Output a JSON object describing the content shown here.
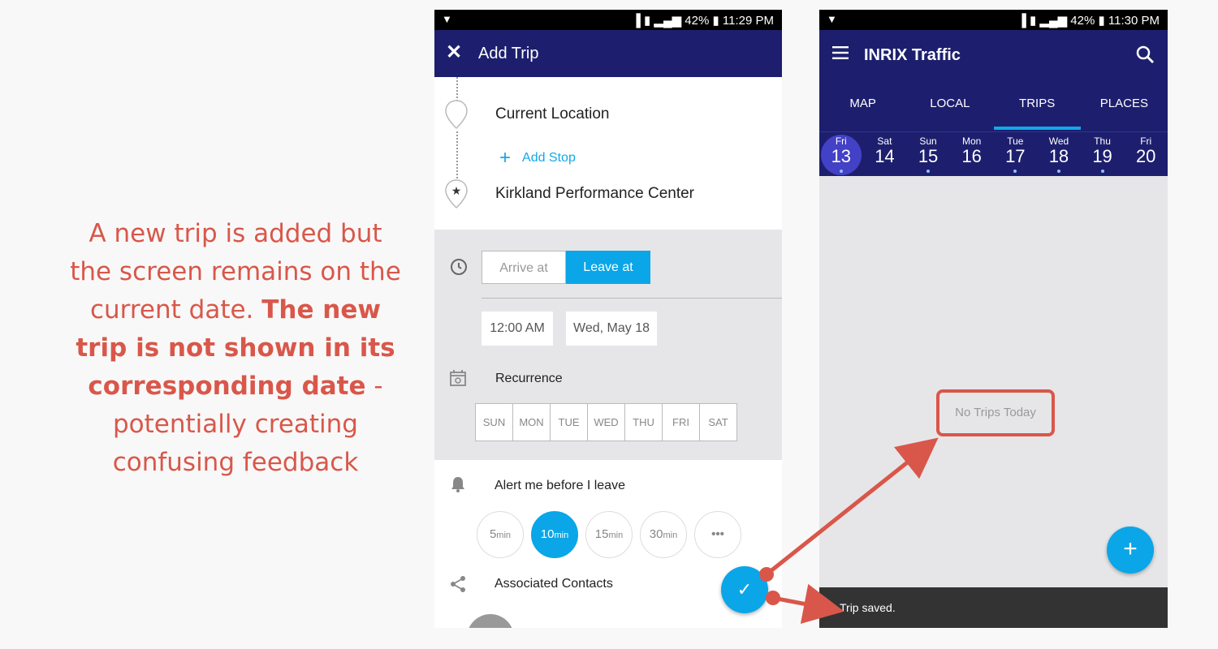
{
  "caption": {
    "part1": "A new trip is added but the screen remains on the current date. ",
    "bold": "The new trip is not shown in its corresponding date",
    "part2": " - potentially creating confusing feedback"
  },
  "phone1": {
    "status": {
      "battery": "42%",
      "time": "11:29 PM"
    },
    "title": "Add Trip",
    "origin": "Current Location",
    "add_stop": "Add Stop",
    "destination": "Kirkland Performance Center",
    "arrive_at": "Arrive at",
    "leave_at": "Leave at",
    "time_value": "12:00 AM",
    "date_value": "Wed, May 18",
    "recurrence_label": "Recurrence",
    "days": [
      "SUN",
      "MON",
      "TUE",
      "WED",
      "THU",
      "FRI",
      "SAT"
    ],
    "alert_label": "Alert me before I leave",
    "alert_options": [
      {
        "num": "5",
        "unit": "min"
      },
      {
        "num": "10",
        "unit": "min"
      },
      {
        "num": "15",
        "unit": "min"
      },
      {
        "num": "30",
        "unit": "min"
      }
    ],
    "more": "•••",
    "contacts_label": "Associated Contacts"
  },
  "phone2": {
    "status": {
      "battery": "42%",
      "time": "11:30 PM"
    },
    "title": "INRIX Traffic",
    "tabs": [
      "MAP",
      "LOCAL",
      "TRIPS",
      "PLACES"
    ],
    "active_tab": "TRIPS",
    "dates": [
      {
        "dow": "Fri",
        "num": "13"
      },
      {
        "dow": "Sat",
        "num": "14"
      },
      {
        "dow": "Sun",
        "num": "15"
      },
      {
        "dow": "Mon",
        "num": "16"
      },
      {
        "dow": "Tue",
        "num": "17"
      },
      {
        "dow": "Wed",
        "num": "18"
      },
      {
        "dow": "Thu",
        "num": "19"
      },
      {
        "dow": "Fri",
        "num": "20"
      }
    ],
    "empty_state": "No Trips Today",
    "snackbar": "Trip saved."
  },
  "colors": {
    "appbar": "#1d1f6e",
    "accent": "#0aa6e8",
    "annotation": "#d9574a"
  }
}
